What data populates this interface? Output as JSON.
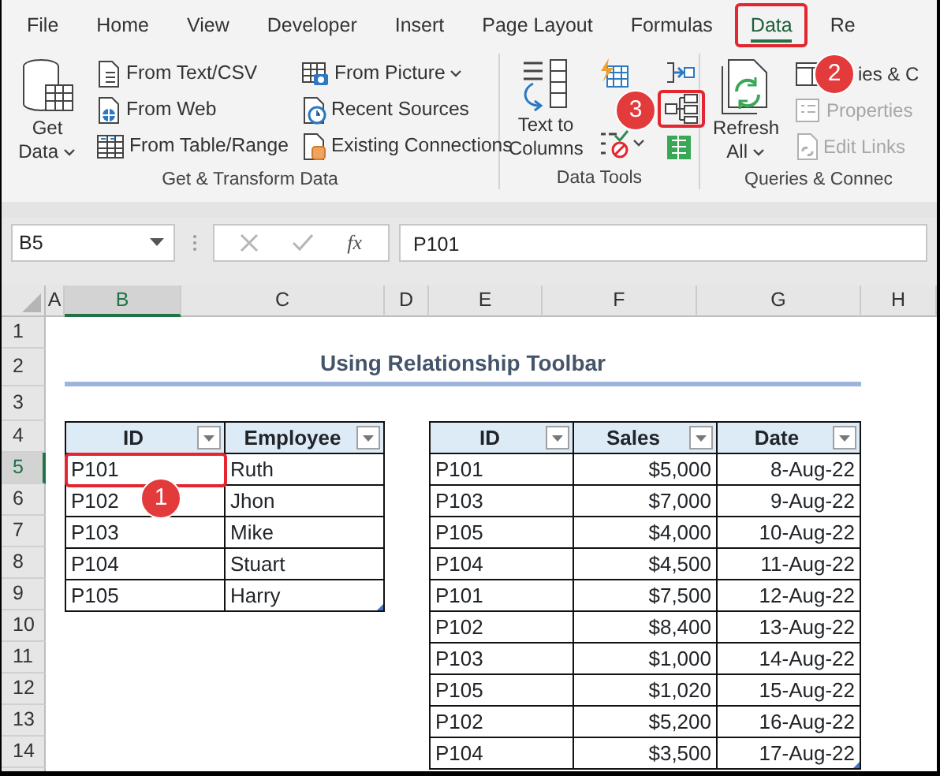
{
  "menu_tabs": [
    {
      "label": "File",
      "selected": false,
      "highlighted": false
    },
    {
      "label": "Home",
      "selected": false,
      "highlighted": false
    },
    {
      "label": "View",
      "selected": false,
      "highlighted": false
    },
    {
      "label": "Developer",
      "selected": false,
      "highlighted": false
    },
    {
      "label": "Insert",
      "selected": false,
      "highlighted": false
    },
    {
      "label": "Page Layout",
      "selected": false,
      "highlighted": false
    },
    {
      "label": "Formulas",
      "selected": false,
      "highlighted": false
    },
    {
      "label": "Data",
      "selected": true,
      "highlighted": true
    },
    {
      "label": "Re",
      "selected": false,
      "highlighted": false
    }
  ],
  "ribbon": {
    "groups": [
      {
        "label": "Get & Transform Data",
        "large": [
          {
            "label": "Get Data",
            "kind": "get-data",
            "dropdown": true
          }
        ],
        "columns": [
          [
            {
              "label": "From Text/CSV",
              "kind": "text-file",
              "dropdown": false
            },
            {
              "label": "From Web",
              "kind": "web",
              "dropdown": false
            },
            {
              "label": "From Table/Range",
              "kind": "table",
              "dropdown": false
            }
          ],
          [
            {
              "label": "From Picture",
              "kind": "picture",
              "dropdown": true
            },
            {
              "label": "Recent Sources",
              "kind": "recent",
              "dropdown": false
            },
            {
              "label": "Existing Connections",
              "kind": "connections",
              "dropdown": false
            }
          ]
        ]
      },
      {
        "label": "Data Tools",
        "large": [
          {
            "label": "Text to Columns",
            "kind": "text-columns",
            "dropdown": false
          }
        ],
        "columns": [
          [
            {
              "kind": "flash-fill",
              "dropdown": false,
              "highlighted": false
            },
            {
              "kind": "validation",
              "dropdown": true,
              "highlighted": false
            }
          ],
          [
            {
              "kind": "consolidate",
              "dropdown": false,
              "highlighted": false
            },
            {
              "kind": "relationships",
              "dropdown": false,
              "highlighted": true
            },
            {
              "kind": "data-model",
              "dropdown": false,
              "highlighted": false
            }
          ]
        ]
      },
      {
        "label": "Queries & Connec",
        "large": [
          {
            "label": "Refresh All",
            "kind": "refresh",
            "dropdown": true
          }
        ],
        "columns": [
          [
            {
              "label": "ies & C",
              "kind": "queries",
              "disabled": false
            },
            {
              "label": "Properties",
              "kind": "properties",
              "disabled": true
            },
            {
              "label": "Edit Links",
              "kind": "links",
              "disabled": true
            }
          ]
        ]
      }
    ]
  },
  "formula_bar": {
    "name_box": "B5",
    "function_label": "fx",
    "value": "P101"
  },
  "sheet": {
    "columns": [
      {
        "label": "A",
        "selected": false
      },
      {
        "label": "B",
        "selected": true
      },
      {
        "label": "C",
        "selected": false
      },
      {
        "label": "D",
        "selected": false
      },
      {
        "label": "E",
        "selected": false
      },
      {
        "label": "F",
        "selected": false
      },
      {
        "label": "G",
        "selected": false
      },
      {
        "label": "H",
        "selected": false
      }
    ],
    "rows": [
      {
        "label": "1",
        "selected": false
      },
      {
        "label": "2",
        "selected": false
      },
      {
        "label": "3",
        "selected": false
      },
      {
        "label": "4",
        "selected": false
      },
      {
        "label": "5",
        "selected": true
      },
      {
        "label": "6",
        "selected": false
      },
      {
        "label": "7",
        "selected": false
      },
      {
        "label": "8",
        "selected": false
      },
      {
        "label": "9",
        "selected": false
      },
      {
        "label": "10",
        "selected": false
      },
      {
        "label": "11",
        "selected": false
      },
      {
        "label": "12",
        "selected": false
      },
      {
        "label": "13",
        "selected": false
      },
      {
        "label": "14",
        "selected": false
      }
    ],
    "title": "Using Relationship Toolbar",
    "employee_table": {
      "columns": [
        {
          "label": "ID",
          "kind": "text"
        },
        {
          "label": "Employee",
          "kind": "text"
        }
      ],
      "rows": [
        [
          {
            "text": "P101",
            "highlighted": true
          },
          {
            "text": "Ruth",
            "highlighted": false
          }
        ],
        [
          {
            "text": "P102",
            "highlighted": false
          },
          {
            "text": "Jhon",
            "highlighted": false
          }
        ],
        [
          {
            "text": "P103",
            "highlighted": false
          },
          {
            "text": "Mike",
            "highlighted": false
          }
        ],
        [
          {
            "text": "P104",
            "highlighted": false
          },
          {
            "text": "Stuart",
            "highlighted": false
          }
        ],
        [
          {
            "text": "P105",
            "highlighted": false
          },
          {
            "text": "Harry",
            "highlighted": false
          }
        ]
      ]
    },
    "sales_table": {
      "columns": [
        {
          "label": "ID",
          "kind": "text"
        },
        {
          "label": "Sales",
          "kind": "number"
        },
        {
          "label": "Date",
          "kind": "number"
        }
      ],
      "rows": [
        [
          "P101",
          "$5,000",
          "8-Aug-22"
        ],
        [
          "P103",
          "$7,000",
          "9-Aug-22"
        ],
        [
          "P105",
          "$4,000",
          "10-Aug-22"
        ],
        [
          "P104",
          "$4,500",
          "11-Aug-22"
        ],
        [
          "P101",
          "$7,500",
          "12-Aug-22"
        ],
        [
          "P102",
          "$8,400",
          "13-Aug-22"
        ],
        [
          "P103",
          "$1,000",
          "14-Aug-22"
        ],
        [
          "P105",
          "$1,020",
          "15-Aug-22"
        ],
        [
          "P102",
          "$5,200",
          "16-Aug-22"
        ],
        [
          "P104",
          "$3,500",
          "17-Aug-22"
        ]
      ]
    }
  },
  "callouts": [
    {
      "number": "1"
    },
    {
      "number": "2"
    },
    {
      "number": "3"
    }
  ]
}
